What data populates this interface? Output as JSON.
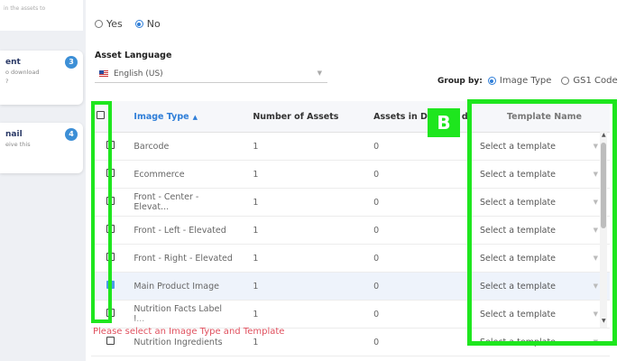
{
  "sidebar": {
    "top_text": "in the assets to",
    "steps": [
      {
        "num": "3",
        "title": "ent",
        "desc1": "o download",
        "desc2": "?"
      },
      {
        "num": "4",
        "title": "nail",
        "desc1": "eive this",
        "desc2": ""
      }
    ]
  },
  "radio_group": {
    "yes": "Yes",
    "no": "No",
    "selected": "No"
  },
  "asset_language": {
    "label": "Asset Language",
    "value": "English (US)"
  },
  "group_by": {
    "label": "Group by:",
    "options": [
      "Image Type",
      "GS1 Code"
    ],
    "selected": "Image Type"
  },
  "table": {
    "columns": [
      "Image Type",
      "Number of Assets",
      "Assets in D",
      "d",
      "Template Name"
    ],
    "rows": [
      {
        "type": "Barcode",
        "count": "1",
        "dl": "0",
        "template": "Select a template",
        "checked": false
      },
      {
        "type": "Ecommerce",
        "count": "1",
        "dl": "0",
        "template": "Select a template",
        "checked": false
      },
      {
        "type": "Front - Center - Elevat...",
        "count": "1",
        "dl": "0",
        "template": "Select a template",
        "checked": false
      },
      {
        "type": "Front - Left - Elevated",
        "count": "1",
        "dl": "0",
        "template": "Select a template",
        "checked": false
      },
      {
        "type": "Front - Right - Elevated",
        "count": "1",
        "dl": "0",
        "template": "Select a template",
        "checked": false
      },
      {
        "type": "Main Product Image",
        "count": "1",
        "dl": "0",
        "template": "Select a template",
        "checked": true
      },
      {
        "type": "Nutrition Facts Label I...",
        "count": "1",
        "dl": "0",
        "template": "Select a template",
        "checked": false
      },
      {
        "type": "Nutrition Ingredients",
        "count": "1",
        "dl": "0",
        "template": "Select a template",
        "checked": false
      }
    ]
  },
  "annotation": {
    "badge": "B",
    "color": "#1ee61e"
  },
  "error_message": "Please select an Image Type and Template",
  "colors": {
    "accent": "#2f7ed8",
    "step_badge": "#3d8fd6",
    "error": "#e0505e"
  }
}
